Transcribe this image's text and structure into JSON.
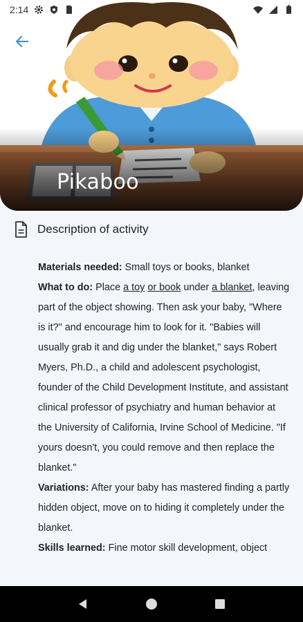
{
  "status_bar": {
    "time": "2:14",
    "icons_left": [
      "gear-icon",
      "shield-icon",
      "sim-card-icon"
    ],
    "icons_right": [
      "wifi-icon",
      "signal-icon",
      "battery-icon"
    ]
  },
  "header": {
    "back_icon": "arrow-left-icon",
    "title": "Pikaboo",
    "accent_color": "#4a8fd6"
  },
  "section": {
    "icon": "document-icon",
    "title": "Description of activity"
  },
  "description": {
    "materials_label": "Materials needed:",
    "materials_text": " Small toys or books, blanket",
    "what_label": "What to do:",
    "what_text_1": " Place ",
    "what_link_1": "a toy",
    "what_sep_1": " ",
    "what_link_2": "or book",
    "what_text_2": " under ",
    "what_link_3": "a blanket",
    "what_text_3": ", leaving part of the object showing. Then ask your baby, \"Where is it?\" and encourage him to look for it. \"Babies will usually grab it and dig under the blanket,\" says Robert Myers, Ph.D., a child and adolescent psychologist, founder of the Child Development Institute, and assistant clinical professor of psychiatry and human behavior at the University of California, Irvine School of Medicine. \"If yours doesn't, you could remove and then replace the blanket.\"",
    "variations_label": "Variations:",
    "variations_text": " After your baby has mastered finding a partly hidden object, move on to hiding it completely under the blanket.",
    "skills_label": "Skills learned:",
    "skills_text": " Fine motor skill development, object"
  },
  "nav_bar": {
    "back": "back-triangle-icon",
    "home": "home-circle-icon",
    "recents": "recents-square-icon"
  }
}
